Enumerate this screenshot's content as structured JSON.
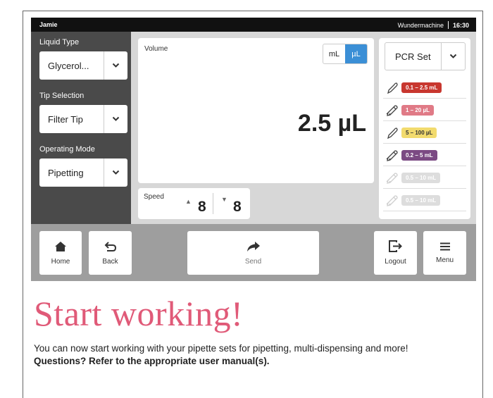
{
  "status_bar": {
    "user": "Jamie",
    "device_name": "Wundermachine",
    "time": "16:30"
  },
  "sidebar": {
    "liquid_type": {
      "label": "Liquid Type",
      "value": "Glycerol..."
    },
    "tip_selection": {
      "label": "Tip Selection",
      "value": "Filter Tip"
    },
    "operating_mode": {
      "label": "Operating Mode",
      "value": "Pipetting"
    }
  },
  "volume": {
    "label": "Volume",
    "units": [
      "mL",
      "µL"
    ],
    "selected_unit": "µL",
    "value": "2.5 µL"
  },
  "speed": {
    "label": "Speed",
    "aspirate": "8",
    "dispense": "8"
  },
  "pipette_set": {
    "selected": "PCR Set",
    "pipettes": [
      {
        "range": "0.1 – 2.5 mL",
        "color": "#c8372f",
        "text_color": "#ffffff",
        "enabled": true,
        "icon": "pipette-icon"
      },
      {
        "range": "1 – 20 µL",
        "color": "#e07a86",
        "text_color": "#ffffff",
        "enabled": true,
        "icon": "pipette-multi-icon"
      },
      {
        "range": "5 – 100 µL",
        "color": "#f2db6e",
        "text_color": "#333333",
        "enabled": true,
        "icon": "pipette-icon"
      },
      {
        "range": "0.2 – 5 mL",
        "color": "#7b4a83",
        "text_color": "#ffffff",
        "enabled": true,
        "icon": "pipette-multi-icon"
      },
      {
        "range": "0.5 – 10 mL",
        "color": "#dddddd",
        "text_color": "#ffffff",
        "enabled": false,
        "icon": "pipette-multi-icon"
      },
      {
        "range": "0.5 – 10 mL",
        "color": "#dddddd",
        "text_color": "#ffffff",
        "enabled": false,
        "icon": "pipette-multi-icon"
      }
    ]
  },
  "nav": {
    "home": "Home",
    "back": "Back",
    "send": "Send",
    "logout": "Logout",
    "menu": "Menu"
  },
  "page": {
    "title": "Start working!",
    "description": "You can now start working with your pipette sets for pipetting, multi-dispensing and more!",
    "question": "Questions? Refer to the appropriate user manual(s)."
  },
  "colors": {
    "accent": "#3b8fd6",
    "title": "#e05a78",
    "sidebar": "#4a4a4a",
    "status_bar": "#111111"
  }
}
